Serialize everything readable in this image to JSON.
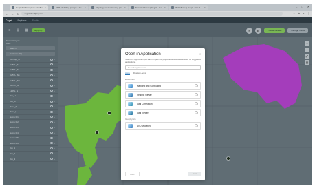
{
  "browser": {
    "tabs": [
      {
        "label": "Cegal Platform | Ges Sandbox",
        "active": true
      },
      {
        "label": "SDR Modelling | Cegal + Ge",
        "active": false
      },
      {
        "label": "Mapping and Contouring | Cegal",
        "active": false
      },
      {
        "label": "Seismic Viewer | Cegal + Go",
        "active": false
      },
      {
        "label": "Well Viewer | Cegal + Go S",
        "active": false
      }
    ],
    "url": "cegal.cloud/projects"
  },
  "app": {
    "brand": "Cegal",
    "nav": [
      "Explorer",
      "Studio"
    ],
    "project_badge": "Mapping 1",
    "buttons": {
      "prospect": "Prospect Views",
      "manage": "Manage Views"
    }
  },
  "left_panel": {
    "header_line1": "Prospect layers",
    "header_line2": "Wells",
    "search_placeholder": "Search",
    "group_label": "Horizons (15)",
    "rows": [
      "C25Top_SI",
      "C25TL_S",
      "C25BL_S",
      "C25TL_SE",
      "C25TL_SB",
      "C25TL_SI",
      "L25TL_S",
      "Top_U",
      "Top_S",
      "Base_S",
      "Base_U",
      "Sumo 0.1",
      "Sumo 0.2",
      "Sumo 0.3",
      "Sumo 0.4",
      "Sumo 0.5",
      "Sumo 0.6",
      "Top_1",
      "Top_2",
      "Top_3"
    ]
  },
  "dialog": {
    "title": "Open in Application",
    "description": "Select the application you want to open this project to or browse workflows for suggested applications.",
    "search_placeholder": "Search applications",
    "tabs": [
      "Apps",
      "Desktop Apps"
    ],
    "sections": [
      {
        "label": "Essentials",
        "apps": [
          {
            "name": "Mapping and Contouring",
            "icon_color": "#3a86c8"
          },
          {
            "name": "Seismic Viewer",
            "icon_color": "#2a6fa8"
          },
          {
            "name": "Well Correlation",
            "icon_color": "#2f8fb0"
          },
          {
            "name": "Well Viewer",
            "icon_color": "#1e6f99"
          }
        ]
      },
      {
        "label": "Geophysics",
        "apps": [
          {
            "name": "AVO Modelling",
            "icon_color": "#3b7fbf"
          }
        ]
      }
    ],
    "back_label": "Back",
    "next_label": "Next",
    "page_dots": 1
  },
  "colors": {
    "green_area": "#7cd33f",
    "magenta_area": "#c040d8",
    "map_bg": "#6d7b82"
  }
}
